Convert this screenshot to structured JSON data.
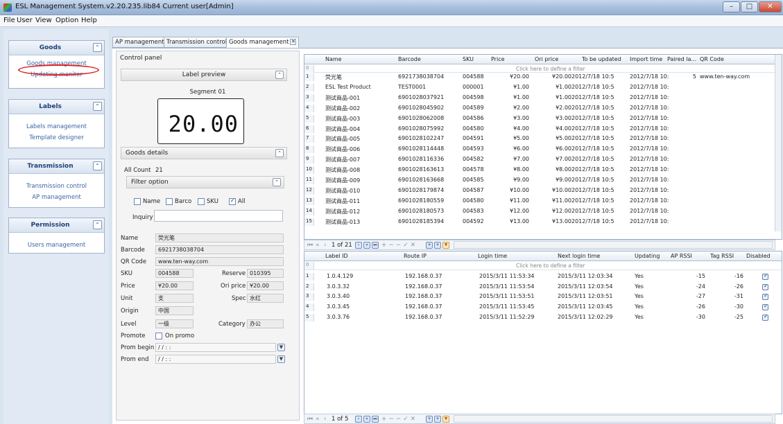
{
  "window": {
    "title": "ESL Management System.v2.20.235.lib84 Current user[Admin]",
    "controls": {
      "minimize": "–",
      "maximize": "□",
      "close": "✕"
    }
  },
  "menu": [
    "File",
    "User",
    "View",
    "Option",
    "Help"
  ],
  "sidebar": {
    "groups": [
      {
        "title": "Goods",
        "items": [
          "Goods management",
          "Updating monitor"
        ]
      },
      {
        "title": "Labels",
        "items": [
          "Labels management",
          "Template designer"
        ]
      },
      {
        "title": "Transmission",
        "items": [
          "Transmission control",
          "AP management"
        ]
      },
      {
        "title": "Permission",
        "items": [
          "Users management"
        ]
      }
    ],
    "collapse_glyph": "⌃"
  },
  "tabs": [
    "AP management",
    "Transmission control",
    "Goods management"
  ],
  "tab_close": "✕",
  "control_panel": {
    "title": "Control panel",
    "label_preview": "Label preview",
    "segment": "Segment 01",
    "lcd_value": "20.00",
    "goods_details": "Goods details",
    "all_count_label": "All Count",
    "all_count": "21",
    "filter_option": "Filter option",
    "filters": [
      {
        "label": "Name",
        "checked": false
      },
      {
        "label": "Barco",
        "checked": false
      },
      {
        "label": "SKU",
        "checked": false
      },
      {
        "label": "All",
        "checked": true
      }
    ],
    "inquiry_label": "Inquiry",
    "inquiry_value": "",
    "collapse_glyph": "⌃",
    "fields": {
      "name_label": "Name",
      "name": "荧光笔",
      "barcode_label": "Barcode",
      "barcode": "6921738038704",
      "qr_label": "QR Code",
      "qr": "www.ten-way.com",
      "sku_label": "SKU",
      "sku": "004588",
      "reserve_label": "Reserve",
      "reserve": "010395",
      "price_label": "Price",
      "price": "¥20.00",
      "ori_price_label": "Ori price",
      "ori_price": "¥20.00",
      "unit_label": "Unit",
      "unit": "支",
      "spec_label": "Spec",
      "spec": "水红",
      "origin_label": "Origin",
      "origin": "中国",
      "level_label": "Level",
      "level": "一级",
      "category_label": "Category",
      "category": "办公",
      "promote_label": "Promote",
      "promote_option": "On promo",
      "prom_begin_label": "Prom begin",
      "prom_begin": "/ /  : :",
      "prom_end_label": "Prom end",
      "prom_end": "/ /  : :"
    }
  },
  "goods_grid": {
    "columns": [
      "Name",
      "Barcode",
      "SKU",
      "Price",
      "Ori price",
      "To be updated",
      "Import time",
      "Paired la...",
      "QR Code"
    ],
    "filter_row": {
      "num": "0",
      "text": "Click here to define a filter"
    },
    "rows": [
      {
        "n": "1",
        "name": "荧光笔",
        "barcode": "6921738038704",
        "sku": "004588",
        "price": "¥20.00",
        "ori": "¥20.00",
        "upd": "2012/7/18 10:5",
        "imp": "2012/7/18 10:",
        "paired": "5",
        "qr": "www.ten-way.com"
      },
      {
        "n": "2",
        "name": "ESL Test Product",
        "barcode": "TEST0001",
        "sku": "000001",
        "price": "¥1.00",
        "ori": "¥1.00",
        "upd": "2012/7/18 10:5",
        "imp": "2012/7/18 10:",
        "paired": "",
        "qr": ""
      },
      {
        "n": "3",
        "name": "测试商品-001",
        "barcode": "6901028037921",
        "sku": "004598",
        "price": "¥1.00",
        "ori": "¥1.00",
        "upd": "2012/7/18 10:5",
        "imp": "2012/7/18 10:",
        "paired": "",
        "qr": ""
      },
      {
        "n": "4",
        "name": "测试商品-002",
        "barcode": "6901028045902",
        "sku": "004589",
        "price": "¥2.00",
        "ori": "¥2.00",
        "upd": "2012/7/18 10:5",
        "imp": "2012/7/18 10:",
        "paired": "",
        "qr": ""
      },
      {
        "n": "5",
        "name": "测试商品-003",
        "barcode": "6901028062008",
        "sku": "004586",
        "price": "¥3.00",
        "ori": "¥3.00",
        "upd": "2012/7/18 10:5",
        "imp": "2012/7/18 10:",
        "paired": "",
        "qr": ""
      },
      {
        "n": "6",
        "name": "测试商品-004",
        "barcode": "6901028075992",
        "sku": "004580",
        "price": "¥4.00",
        "ori": "¥4.00",
        "upd": "2012/7/18 10:5",
        "imp": "2012/7/18 10:",
        "paired": "",
        "qr": ""
      },
      {
        "n": "7",
        "name": "测试商品-005",
        "barcode": "6901028102247",
        "sku": "004591",
        "price": "¥5.00",
        "ori": "¥5.00",
        "upd": "2012/7/18 10:5",
        "imp": "2012/7/18 10:",
        "paired": "",
        "qr": ""
      },
      {
        "n": "8",
        "name": "测试商品-006",
        "barcode": "6901028114448",
        "sku": "004593",
        "price": "¥6.00",
        "ori": "¥6.00",
        "upd": "2012/7/18 10:5",
        "imp": "2012/7/18 10:",
        "paired": "",
        "qr": ""
      },
      {
        "n": "9",
        "name": "测试商品-007",
        "barcode": "6901028116336",
        "sku": "004582",
        "price": "¥7.00",
        "ori": "¥7.00",
        "upd": "2012/7/18 10:5",
        "imp": "2012/7/18 10:",
        "paired": "",
        "qr": ""
      },
      {
        "n": "10",
        "name": "测试商品-008",
        "barcode": "6901028163613",
        "sku": "004578",
        "price": "¥8.00",
        "ori": "¥8.00",
        "upd": "2012/7/18 10:5",
        "imp": "2012/7/18 10:",
        "paired": "",
        "qr": ""
      },
      {
        "n": "11",
        "name": "测试商品-009",
        "barcode": "6901028163668",
        "sku": "004585",
        "price": "¥9.00",
        "ori": "¥9.00",
        "upd": "2012/7/18 10:5",
        "imp": "2012/7/18 10:",
        "paired": "",
        "qr": ""
      },
      {
        "n": "12",
        "name": "测试商品-010",
        "barcode": "6901028179874",
        "sku": "004587",
        "price": "¥10.00",
        "ori": "¥10.00",
        "upd": "2012/7/18 10:5",
        "imp": "2012/7/18 10:",
        "paired": "",
        "qr": ""
      },
      {
        "n": "13",
        "name": "测试商品-011",
        "barcode": "6901028180559",
        "sku": "004580",
        "price": "¥11.00",
        "ori": "¥11.00",
        "upd": "2012/7/18 10:5",
        "imp": "2012/7/18 10:",
        "paired": "",
        "qr": ""
      },
      {
        "n": "14",
        "name": "测试商品-012",
        "barcode": "6901028180573",
        "sku": "004583",
        "price": "¥12.00",
        "ori": "¥12.00",
        "upd": "2012/7/18 10:5",
        "imp": "2012/7/18 10:",
        "paired": "",
        "qr": ""
      },
      {
        "n": "15",
        "name": "测试商品-013",
        "barcode": "6901028185394",
        "sku": "004592",
        "price": "¥13.00",
        "ori": "¥13.00",
        "upd": "2012/7/18 10:5",
        "imp": "2012/7/18 10:",
        "paired": "",
        "qr": ""
      }
    ],
    "pager": "1 of 21"
  },
  "label_grid": {
    "columns": [
      "Label ID",
      "Route IP",
      "Login time",
      "Next login time",
      "Updating",
      "AP RSSI",
      "Tag RSSI",
      "Disabled"
    ],
    "filter_row": {
      "num": "0",
      "text": "Click here to define a filter"
    },
    "rows": [
      {
        "n": "1",
        "id": "1.0.4.129",
        "ip": "192.168.0.37",
        "login": "2015/3/11 11:53:34",
        "next": "2015/3/11 12:03:34",
        "upd": "Yes",
        "ap": "-15",
        "tag": "-16",
        "disabled": true
      },
      {
        "n": "2",
        "id": "3.0.3.32",
        "ip": "192.168.0.37",
        "login": "2015/3/11 11:53:54",
        "next": "2015/3/11 12:03:54",
        "upd": "Yes",
        "ap": "-24",
        "tag": "-26",
        "disabled": true
      },
      {
        "n": "3",
        "id": "3.0.3.40",
        "ip": "192.168.0.37",
        "login": "2015/3/11 11:53:51",
        "next": "2015/3/11 12:03:51",
        "upd": "Yes",
        "ap": "-27",
        "tag": "-31",
        "disabled": true
      },
      {
        "n": "4",
        "id": "3.0.3.45",
        "ip": "192.168.0.37",
        "login": "2015/3/11 11:53:45",
        "next": "2015/3/11 12:03:45",
        "upd": "Yes",
        "ap": "-26",
        "tag": "-30",
        "disabled": true
      },
      {
        "n": "5",
        "id": "3.0.3.76",
        "ip": "192.168.0.37",
        "login": "2015/3/11 11:52:29",
        "next": "2015/3/11 12:02:29",
        "upd": "Yes",
        "ap": "-30",
        "tag": "-25",
        "disabled": true
      }
    ],
    "pager": "1 of 5"
  },
  "pager_glyphs": {
    "first": "⏮",
    "prev_page": "«",
    "prev": "‹",
    "next": "›",
    "next_page": "»",
    "last": "⏭",
    "add": "+",
    "ops": "+ − − ✓ ✕",
    "filter": "▼"
  },
  "colors": {
    "accent": "#1e3f78",
    "link": "#3a63a8",
    "highlight_circle": "#dd2222",
    "titlebar": "#a8bfdc"
  }
}
